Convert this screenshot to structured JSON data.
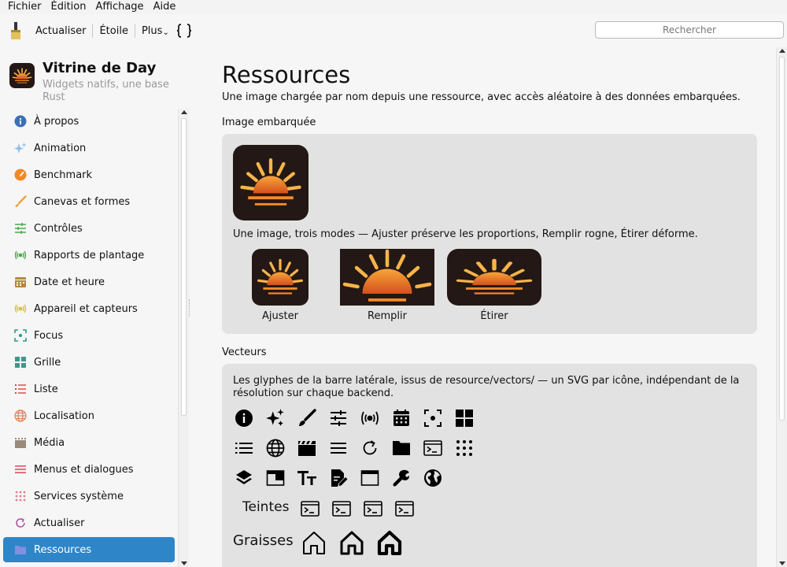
{
  "menubar": {
    "items": [
      "Fichier",
      "Édition",
      "Affichage",
      "Aide"
    ]
  },
  "toolbar": {
    "refresh_label": "Actualiser",
    "star_label": "Étoile",
    "more_label": "Plus",
    "more_chevron": "⌄",
    "braces_label": "{ }",
    "search_placeholder": "Rechercher"
  },
  "app": {
    "title": "Vitrine de Day",
    "subtitle": "Widgets natifs, une base Rust"
  },
  "sidebar": {
    "items": [
      {
        "label": "À propos",
        "icon": "info-icon",
        "color": "#3d6fb5"
      },
      {
        "label": "Animation",
        "icon": "sparkle-icon",
        "color": "#8cc0ee"
      },
      {
        "label": "Benchmark",
        "icon": "gauge-icon",
        "color": "#f08a24"
      },
      {
        "label": "Canevas et formes",
        "icon": "brush-icon",
        "color": "#f0a040"
      },
      {
        "label": "Contrôles",
        "icon": "sliders-icon",
        "color": "#4aa84a"
      },
      {
        "label": "Rapports de plantage",
        "icon": "broadcast-icon",
        "color": "#4aa84a"
      },
      {
        "label": "Date et heure",
        "icon": "calendar-icon",
        "color": "#b08a3a"
      },
      {
        "label": "Appareil et capteurs",
        "icon": "broadcast-icon",
        "color": "#d8c030"
      },
      {
        "label": "Focus",
        "icon": "focus-icon",
        "color": "#2a9a8a"
      },
      {
        "label": "Grille",
        "icon": "grid-icon",
        "color": "#3a9a8a"
      },
      {
        "label": "Liste",
        "icon": "list-icon",
        "color": "#e04040"
      },
      {
        "label": "Localisation",
        "icon": "globe-icon",
        "color": "#e08060"
      },
      {
        "label": "Média",
        "icon": "film-icon",
        "color": "#9a8a7a"
      },
      {
        "label": "Menus et dialogues",
        "icon": "menu-icon",
        "color": "#e05060"
      },
      {
        "label": "Services système",
        "icon": "dots-icon",
        "color": "#e08090"
      },
      {
        "label": "Actualiser",
        "icon": "refresh-icon",
        "color": "#b050a0"
      },
      {
        "label": "Ressources",
        "icon": "folder-icon",
        "color": "#8090e0"
      }
    ],
    "active_index": 16
  },
  "main": {
    "title": "Ressources",
    "description": "Une image chargée par nom depuis une ressource, avec accès aléatoire à des données embarquées.",
    "embedded": {
      "section_title": "Image embarquée",
      "modes_text": "Une image, trois modes — Ajuster préserve les proportions, Remplir rogne, Étirer déforme.",
      "modes": [
        "Ajuster",
        "Remplir",
        "Étirer"
      ]
    },
    "vectors": {
      "section_title": "Vecteurs",
      "text": "Les glyphes de la barre latérale, issus de resource/vectors/ — un SVG par icône, indépendant de la résolution sur chaque backend.",
      "rows": [
        [
          "info-icon",
          "sparkle-icon",
          "brush-icon",
          "sliders-icon",
          "broadcast-icon",
          "calendar-icon",
          "focus-icon",
          "grid-icon"
        ],
        [
          "list-icon",
          "globe-icon",
          "film-icon",
          "menu-icon",
          "refresh-icon",
          "folder-icon",
          "terminal-icon",
          "dots-icon"
        ],
        [
          "layers-icon",
          "window-split-icon",
          "text-size-icon",
          "edit-document-icon",
          "window-icon",
          "wrench-icon",
          "earth-icon"
        ]
      ],
      "tints_label": "Teintes",
      "tints": [
        "terminal-icon",
        "terminal-icon",
        "terminal-icon",
        "terminal-icon"
      ],
      "weights_label": "Graisses",
      "weights": [
        "home-icon",
        "home-icon",
        "home-icon"
      ]
    }
  },
  "colors": {
    "accent": "#2e86c9",
    "panel": "#e2e2e2",
    "sun_bg": "#231815",
    "sun_orange": "#f28c28",
    "sun_yellow": "#ffc04a"
  }
}
